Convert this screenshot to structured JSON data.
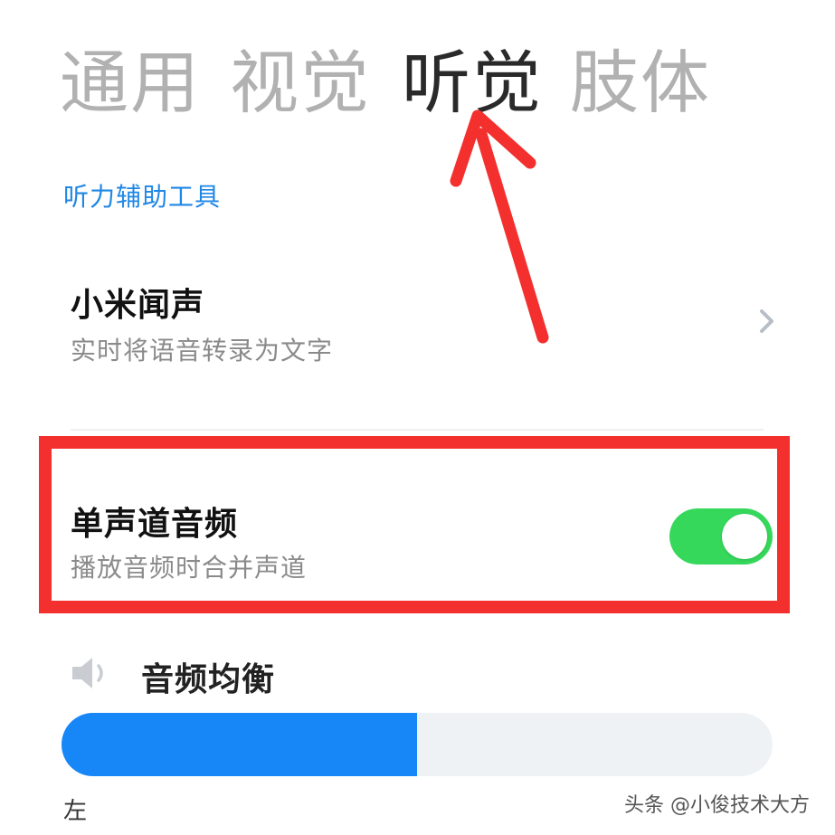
{
  "tabs": [
    {
      "label": "通用",
      "active": false
    },
    {
      "label": "视觉",
      "active": false
    },
    {
      "label": "听觉",
      "active": true
    },
    {
      "label": "肢体",
      "active": false
    }
  ],
  "section_header": "听力辅助工具",
  "mi_hearing": {
    "title": "小米闻声",
    "subtitle": "实时将语音转录为文字",
    "icon": "chevron-right-icon"
  },
  "mono_audio": {
    "title": "单声道音频",
    "subtitle": "播放音频时合并声道",
    "enabled": true,
    "toggle_color": "#35d85b"
  },
  "audio_balance": {
    "title": "音频均衡",
    "icon": "speaker-icon",
    "level": 0.5,
    "fill_color": "#1787f7",
    "left_label": "左"
  },
  "annotation": {
    "highlight_color": "#f3302e",
    "arrow_color": "#f3302e"
  },
  "watermark": "头条 @小俊技术大方"
}
